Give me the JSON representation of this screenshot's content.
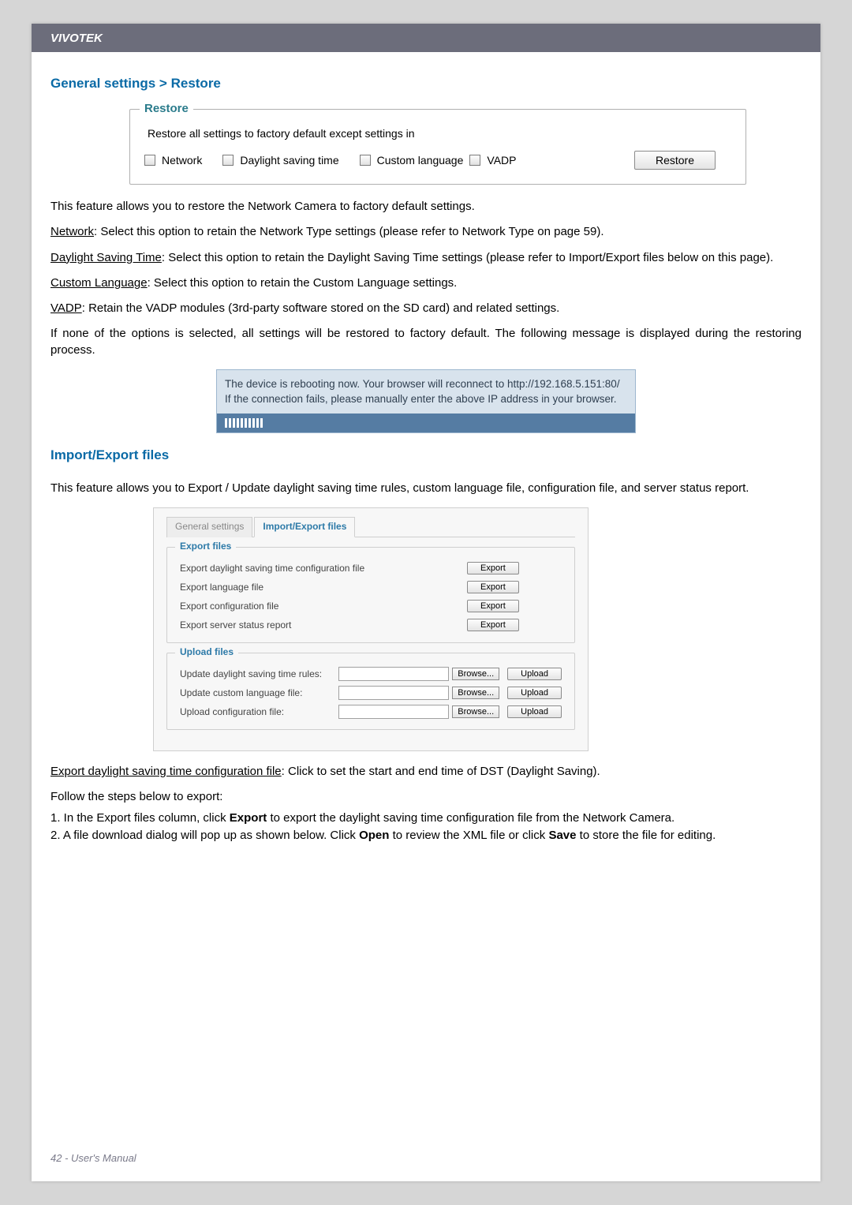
{
  "brand": "VIVOTEK",
  "section1_title": "General settings > Restore",
  "restore_panel": {
    "legend": "Restore",
    "desc": "Restore all settings to factory default except settings in",
    "opts": [
      "Network",
      "Daylight saving time",
      "Custom language",
      "VADP"
    ],
    "button": "Restore"
  },
  "p_intro": "This feature allows you to restore the Network Camera to factory default settings.",
  "p_network_label": "Network",
  "p_network": ": Select this option to retain the Network Type settings (please refer to Network Type on page 59).",
  "p_dst_label": "Daylight Saving Time",
  "p_dst": ": Select this option to retain the Daylight Saving Time settings (please refer to Import/Export files below on this page).",
  "p_cl_label": "Custom Language",
  "p_cl": ": Select this option to retain the Custom Language settings.",
  "p_vadp_label": "VADP",
  "p_vadp": ": Retain the VADP modules (3rd-party software stored on the SD card) and related settings.",
  "p_none": "If none of the options is selected, all settings will be restored to factory default.  The following message is displayed during the restoring process.",
  "reboot_msg1": "The device is rebooting now. Your browser will reconnect to http://192.168.5.151:80/",
  "reboot_msg2": "If the connection fails, please manually enter the above IP address in your browser.",
  "section2_title": "Import/Export files",
  "p_ie_intro": "This feature allows you to Export / Update daylight saving time rules, custom language file, configuration file, and server status report.",
  "ie_panel": {
    "tabs": [
      "General settings",
      "Import/Export files"
    ],
    "export_legend": "Export files",
    "export_rows": [
      "Export daylight saving time configuration file",
      "Export language file",
      "Export configuration file",
      "Export server status report"
    ],
    "export_btn": "Export",
    "upload_legend": "Upload files",
    "upload_rows": [
      "Update daylight saving time rules:",
      "Update custom language file:",
      "Upload configuration file:"
    ],
    "browse_btn": "Browse...",
    "upload_btn": "Upload"
  },
  "p_export_label": "Export daylight saving time configuration file",
  "p_export": ": Click to set the start and end time of DST (Daylight Saving).",
  "steps_intro": "Follow the steps below to export:",
  "step1_pre": "1. In the Export files column, click ",
  "step1_bold": "Export",
  "step1_post": " to export the daylight saving time configuration file from the Network Camera.",
  "step2_pre": "2. A file download dialog will pop up as shown below. Click ",
  "step2_bold1": "Open",
  "step2_mid": " to review the XML file or click ",
  "step2_bold2": "Save",
  "step2_post": " to store the file for editing.",
  "footer": "42 - User's Manual"
}
